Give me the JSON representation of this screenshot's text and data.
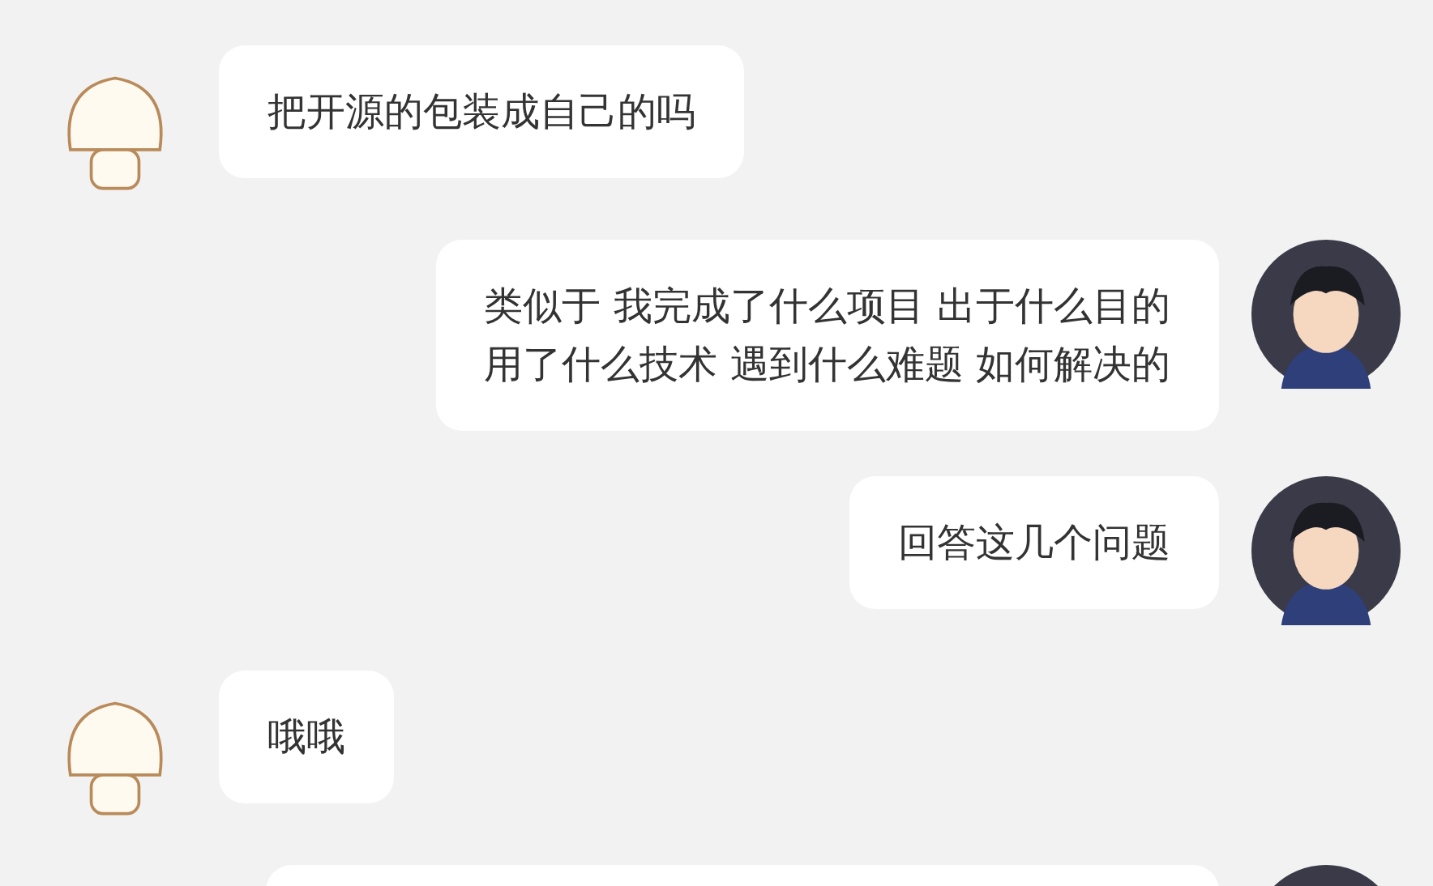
{
  "messages": [
    {
      "kind": "received",
      "lines": [
        "把开源的包装成自己的吗"
      ]
    },
    {
      "kind": "sent",
      "lines": [
        "类似于 我完成了什么项目 出于什么目的",
        "用了什么技术 遇到什么难题 如何解决的"
      ]
    },
    {
      "kind": "sent",
      "lines": [
        "回答这几个问题"
      ]
    },
    {
      "kind": "received",
      "lines": [
        "哦哦"
      ]
    },
    {
      "kind": "sent"
    }
  ]
}
